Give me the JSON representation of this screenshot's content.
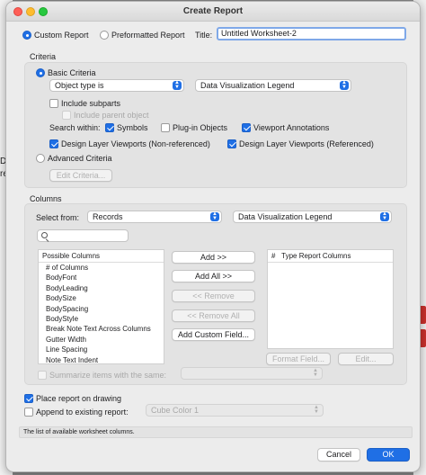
{
  "window": {
    "title": "Create Report"
  },
  "report_type": {
    "custom_label": "Custom Report",
    "preformatted_label": "Preformatted Report",
    "title_label": "Title:",
    "title_value": "Untitled Worksheet-2"
  },
  "criteria": {
    "section_label": "Criteria",
    "basic_label": "Basic Criteria",
    "object_type_select": "Object type is",
    "object_value_select": "Data Visualization Legend",
    "include_subparts": "Include subparts",
    "include_parent": "Include parent object",
    "search_within_label": "Search within:",
    "symbols": "Symbols",
    "plugin_objects": "Plug-in Objects",
    "viewport_annotations": "Viewport Annotations",
    "dlv_nonref": "Design Layer Viewports (Non-referenced)",
    "dlv_ref": "Design Layer Viewports (Referenced)",
    "advanced_label": "Advanced Criteria",
    "edit_criteria_button": "Edit Criteria..."
  },
  "columns": {
    "section_label": "Columns",
    "select_from_label": "Select from:",
    "source_select": "Records",
    "record_select": "Data Visualization Legend",
    "possible_header": "Possible Columns",
    "possible_items": [
      "# of Columns",
      "BodyFont",
      "BodyLeading",
      "BodySize",
      "BodySpacing",
      "BodyStyle",
      "Break Note Text Across Columns",
      "Gutter Width",
      "Line Spacing",
      "Note Text Indent"
    ],
    "type_header_hash": "#",
    "type_header_label": "Type Report Columns",
    "add_button": "Add >>",
    "add_all_button": "Add All >>",
    "remove_button": "<< Remove",
    "remove_all_button": "<< Remove All",
    "add_custom_button": "Add Custom Field...",
    "format_field_button": "Format Field...",
    "edit_button": "Edit...",
    "summarize_label": "Summarize items with the same:"
  },
  "placement": {
    "place_on_drawing": "Place report on drawing",
    "append_label": "Append to existing report:",
    "append_select": "Cube Color 1"
  },
  "status_text": "The list of available worksheet columns.",
  "footer": {
    "cancel": "Cancel",
    "ok": "OK"
  },
  "background": {
    "left_letters": [
      "D",
      "re"
    ]
  },
  "colors": {
    "accent": "#1f6fe5"
  }
}
